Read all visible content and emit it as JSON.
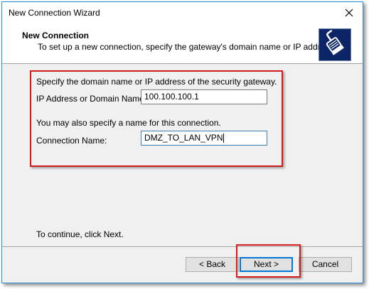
{
  "window": {
    "title": "New Connection Wizard"
  },
  "header": {
    "title": "New Connection",
    "subtitle": "To set up a new connection, specify the gateway's domain name or IP address."
  },
  "form": {
    "intro": "Specify the domain name or IP address of the security gateway.",
    "ip_label": "IP Address or Domain Name:",
    "ip_value": "100.100.100.1",
    "name_hint": "You may also specify a name for this connection.",
    "name_label": "Connection Name:",
    "name_value": "DMZ_TO_LAN_VPN"
  },
  "footer": {
    "hint": "To continue, click Next.",
    "back_label": "< Back",
    "next_label": "Next >",
    "cancel_label": "Cancel"
  },
  "colors": {
    "highlight": "#d21d1d",
    "accent": "#0078d7",
    "icon_bg": "#0b2566"
  },
  "icons": {
    "close": "close-icon",
    "header": "network-cable-icon"
  }
}
